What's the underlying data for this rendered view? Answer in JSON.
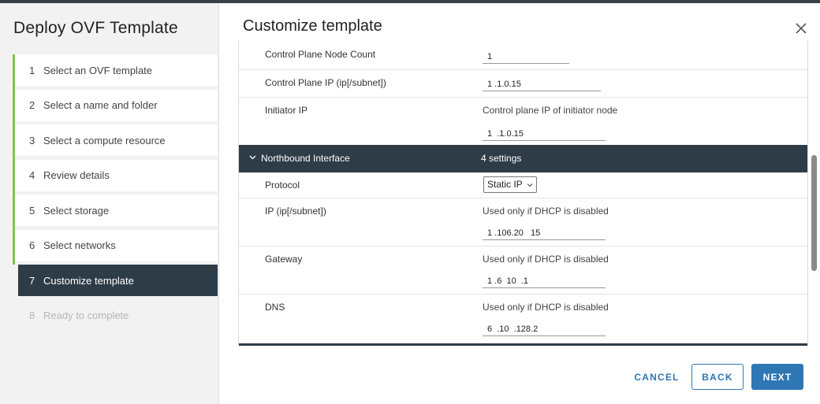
{
  "wizard": {
    "title": "Deploy OVF Template",
    "steps": [
      {
        "num": "1",
        "label": "Select an OVF template"
      },
      {
        "num": "2",
        "label": "Select a name and folder"
      },
      {
        "num": "3",
        "label": "Select a compute resource"
      },
      {
        "num": "4",
        "label": "Review details"
      },
      {
        "num": "5",
        "label": "Select storage"
      },
      {
        "num": "6",
        "label": "Select networks"
      },
      {
        "num": "7",
        "label": "Customize template"
      },
      {
        "num": "8",
        "label": "Ready to complete"
      }
    ],
    "active_step": 7
  },
  "dialog": {
    "title": "Customize template",
    "close_icon": "close-icon"
  },
  "rows": {
    "cp_node_count": {
      "label": "Control Plane Node Count",
      "value": "1"
    },
    "cp_ip": {
      "label": "Control Plane IP (ip[/subnet])",
      "value": "1 .1.0.15"
    },
    "initiator_ip": {
      "label": "Initiator IP",
      "desc": "Control plane IP of initiator node",
      "value": "1  .1.0.15"
    }
  },
  "northbound": {
    "label": "Northbound Interface",
    "count": "4 settings",
    "protocol": {
      "label": "Protocol",
      "value": "Static IP"
    },
    "ip": {
      "label": "IP (ip[/subnet])",
      "desc": "Used only if DHCP is disabled",
      "value": "1 .106.20   15"
    },
    "gateway": {
      "label": "Gateway",
      "desc": "Used only if DHCP is disabled",
      "value": "1 .6  10  .1"
    },
    "dns": {
      "label": "DNS",
      "desc": "Used only if DHCP is disabled",
      "value": "6  .10  .128.2"
    }
  },
  "footer": {
    "cancel": "CANCEL",
    "back": "BACK",
    "next": "NEXT"
  },
  "colors": {
    "accent": "#2e77b4",
    "active_bg": "#2e3c48",
    "complete_marker": "#7dc452"
  }
}
